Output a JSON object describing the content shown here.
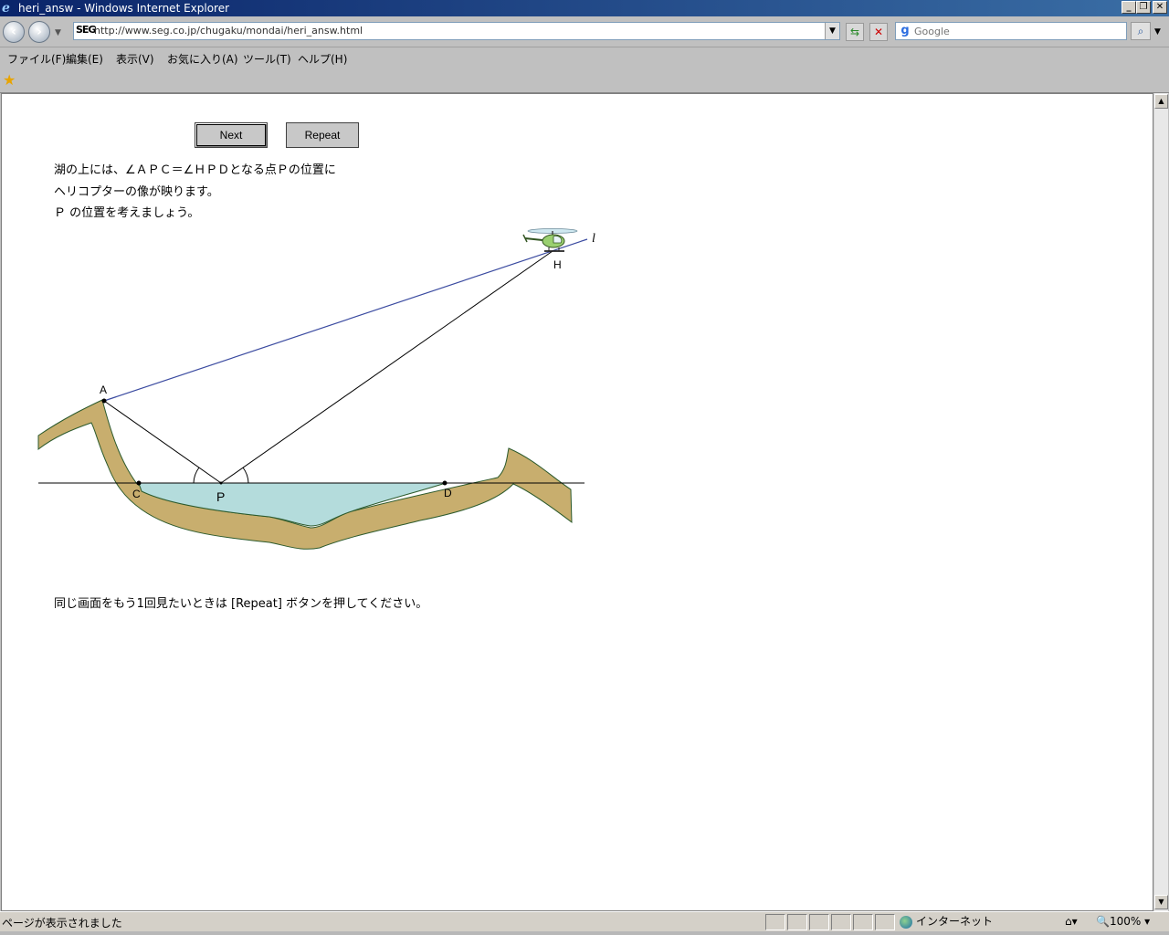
{
  "window": {
    "title": "heri_answ - Windows Internet Explorer"
  },
  "address": {
    "brand": "SEG",
    "url": "http://www.seg.co.jp/chugaku/mondai/heri_answ.html"
  },
  "search": {
    "placeholder": "Google"
  },
  "menu": {
    "items": [
      "ファイル(F)",
      "編集(E)",
      "表示(V)",
      "お気に入り(A)",
      "ツール(T)",
      "ヘルプ(H)"
    ]
  },
  "page": {
    "buttons": {
      "next": "Next",
      "repeat": "Repeat"
    },
    "intro_lines": [
      "湖の上には、∠ＡＰＣ＝∠ＨＰＤとなる点Ｐの位置に",
      "ヘリコプターの像が映ります。",
      "Ｐ の位置を考えましょう。"
    ],
    "diagram_labels": {
      "A": "A",
      "C": "C",
      "P": "P",
      "D": "D",
      "H": "H",
      "l": "l"
    },
    "footer": "同じ画面をもう1回見たいときは [Repeat] ボタンを押してください。"
  },
  "status": {
    "text": "ページが表示されました",
    "zone": "インターネット",
    "zoom": "100%"
  },
  "colors": {
    "water": "#b4dcdc",
    "earth": "#c8ae6e",
    "line_blue": "#3a4aa0",
    "titlebar": "#0a246a"
  }
}
